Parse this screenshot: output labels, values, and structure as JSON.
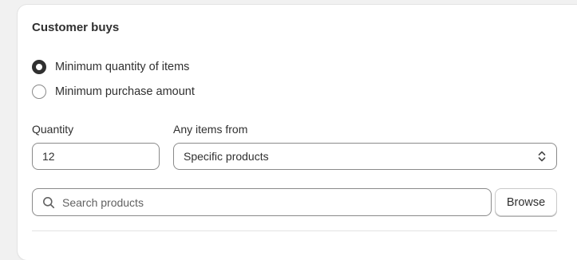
{
  "section": {
    "title": "Customer buys"
  },
  "options": [
    {
      "label": "Minimum quantity of items",
      "selected": true
    },
    {
      "label": "Minimum purchase amount",
      "selected": false
    }
  ],
  "quantity": {
    "label": "Quantity",
    "value": "12"
  },
  "items_from": {
    "label": "Any items from",
    "selected": "Specific products",
    "icon": "select-chevrons-icon"
  },
  "search": {
    "placeholder": "Search products",
    "icon": "search-icon"
  },
  "browse": {
    "label": "Browse"
  },
  "colors": {
    "text": "#303030",
    "border": "#8a8a8a",
    "card": "#ffffff",
    "background": "#f1f1f1"
  }
}
